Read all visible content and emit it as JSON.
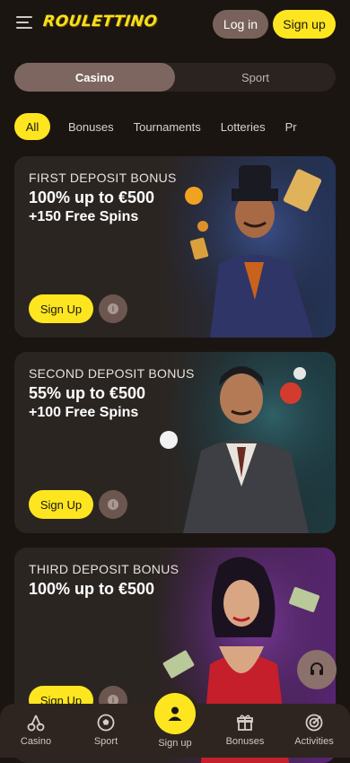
{
  "header": {
    "logo": "ROULETTINO",
    "login_label": "Log in",
    "signup_label": "Sign up"
  },
  "switch": {
    "casino": "Casino",
    "sport": "Sport",
    "active": "Casino"
  },
  "categories": [
    "All",
    "Bonuses",
    "Tournaments",
    "Lotteries",
    "Pr"
  ],
  "promos": [
    {
      "kicker": "FIRST DEPOSIT BONUS",
      "offer": "100% up to €500",
      "extra": "+150 Free Spins",
      "cta": "Sign Up",
      "info_icon": "i"
    },
    {
      "kicker": "SECOND DEPOSIT BONUS",
      "offer": "55% up to €500",
      "extra": "+100 Free Spins",
      "cta": "Sign Up",
      "info_icon": "i"
    },
    {
      "kicker": "THIRD DEPOSIT BONUS",
      "offer": "100% up to €500",
      "extra": "",
      "cta": "Sign Up",
      "info_icon": "i"
    }
  ],
  "bottom_nav": [
    {
      "label": "Casino",
      "icon": "cherries-icon"
    },
    {
      "label": "Sport",
      "icon": "ball-icon"
    },
    {
      "label": "Sign up",
      "icon": "user-icon"
    },
    {
      "label": "Bonuses",
      "icon": "gift-icon"
    },
    {
      "label": "Activities",
      "icon": "target-icon"
    }
  ],
  "colors": {
    "accent": "#fde61f",
    "background": "#1b1512",
    "card": "#2b2522",
    "muted_button": "#7a625c"
  }
}
